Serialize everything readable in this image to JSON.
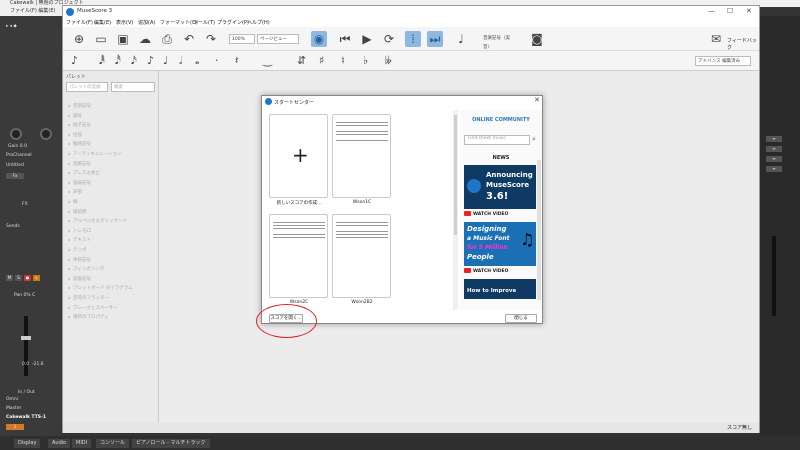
{
  "cakewalk": {
    "title": "Cakewalk | 無題のプロジェクト",
    "subtitle": "ファイル(F)  編集(E)",
    "channel_name": "ProChannel",
    "track_name": "Untitled",
    "fx_label": "FX",
    "sends_label": "Sends",
    "pan_label": "Pan 0% C",
    "io_label": "In / Out",
    "in_label": "Omni",
    "out_label": "Master",
    "synth_label": "Cakewalk TTS-1",
    "gain_label": "Gain 0.0",
    "level_left": "0.0",
    "level_right": "-21.6",
    "bottom_tabs": [
      "Display",
      "Audio",
      "MIDI",
      "コンソール",
      "ピアノロール - マルチトラック"
    ]
  },
  "musescore": {
    "title": "MuseScore 3",
    "menu": [
      "ファイル(F)",
      "編集(E)",
      "表示(V)",
      "追加(A)",
      "フォーマット(O)",
      "ツール(T)",
      "プラグイン(P)",
      "ヘルプ(H)"
    ],
    "zoom_value": "100%",
    "view_mode": "ページビュー",
    "concert_pitch": "音楽記号（実音）",
    "feedback": "フィードバック",
    "workspace": "アドバンス 編集済み",
    "palette_title": "パレット",
    "palette_add": "パレットの追加",
    "palette_search": "検索",
    "palette_items": [
      "音部記号",
      "調号",
      "拍子記号",
      "括弧",
      "臨時記号",
      "アーティキュレーション",
      "装飾記号",
      "ブレス＆休止",
      "強弱記号",
      "声部",
      "線",
      "線装飾",
      "アルペジオ＆グリッサンド",
      "トレモロ",
      "テキスト",
      "テンポ",
      "休符記号",
      "フィンガリング",
      "反復記号",
      "フレットボード ダイアグラム",
      "音符のフラッター",
      "ブレークとスペーサー",
      "場所のプロパティ"
    ],
    "status_text": "スコア無し"
  },
  "dialog": {
    "title": "スタートセンター",
    "new_score_label": "新しいスコアの作成...",
    "scores": [
      "Wson1C",
      "Wson2C",
      "Wson2B2"
    ],
    "community_title": "ONLINE COMMUNITY",
    "search_placeholder": "Find sheet music",
    "news_label": "NEWS",
    "promo1_line1": "Announcing",
    "promo1_line2": "MuseScore",
    "promo1_line3": "3.6!",
    "promo2_line1": "Designing",
    "promo2_line2": "a Music Font",
    "promo2_line3": "for 5 Million",
    "promo2_line4": "People",
    "promo3_line1": "How to Improve",
    "watch_video": "WATCH VIDEO",
    "open_score_button": "スコアを開く...",
    "close_button": "閉じる"
  },
  "colors": {
    "accent": "#2a7dbe",
    "promo_bg": "#0e3a64",
    "annotation": "#e02020"
  }
}
